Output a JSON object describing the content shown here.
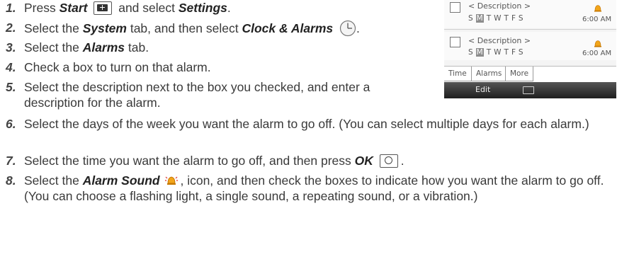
{
  "steps": [
    {
      "num": "1.",
      "parts": [
        {
          "t": "Press "
        },
        {
          "t": "Start",
          "b": true
        },
        {
          "t": " "
        },
        {
          "icon": "start-key-icon"
        },
        {
          "t": " and select "
        },
        {
          "t": "Settings",
          "b": true
        },
        {
          "t": "."
        }
      ]
    },
    {
      "num": "2.",
      "parts": [
        {
          "t": "Select the "
        },
        {
          "t": "System",
          "b": true
        },
        {
          "t": " tab, and then select "
        },
        {
          "t": "Clock & Alarms",
          "b": true
        },
        {
          "t": " "
        },
        {
          "icon": "clock-icon"
        },
        {
          "t": "."
        }
      ]
    },
    {
      "num": "3.",
      "parts": [
        {
          "t": "Select the "
        },
        {
          "t": "Alarms",
          "b": true
        },
        {
          "t": " tab."
        }
      ]
    },
    {
      "num": "4.",
      "parts": [
        {
          "t": "Check a box to turn on that alarm."
        }
      ]
    },
    {
      "num": "5.",
      "parts": [
        {
          "t": "Select the description next to the box you checked, and enter a description for the alarm."
        }
      ]
    },
    {
      "num": "6.",
      "parts": [
        {
          "t": "Select the days of the week you want the alarm to go off. (You can select multiple days for each alarm.)"
        }
      ]
    },
    {
      "num": "7.",
      "parts": [
        {
          "t": "Select the time you want the alarm to go off, and then press "
        },
        {
          "t": "OK",
          "b": true
        },
        {
          "t": " "
        },
        {
          "icon": "ok-key-icon"
        },
        {
          "t": "."
        }
      ]
    },
    {
      "num": "8.",
      "parts": [
        {
          "t": "Select the "
        },
        {
          "t": "Alarm Sound",
          "b": true
        },
        {
          "t": " "
        },
        {
          "icon": "alarm-sound-icon"
        },
        {
          "t": ", icon, and then check the boxes to indicate how you want the alarm to go off. (You can choose a flashing light, a single sound, a repeating sound, or a vibration.)"
        }
      ]
    }
  ],
  "phone": {
    "alarms": [
      {
        "description": "< Description >",
        "days": [
          "S",
          "M",
          "T",
          "W",
          "T",
          "F",
          "S"
        ],
        "time": "6:00 AM"
      },
      {
        "description": "< Description >",
        "days": [
          "S",
          "M",
          "T",
          "W",
          "T",
          "F",
          "S"
        ],
        "time": "6:00 AM"
      }
    ],
    "tabs": [
      "Time",
      "Alarms",
      "More"
    ],
    "softkey_left": "Edit"
  }
}
